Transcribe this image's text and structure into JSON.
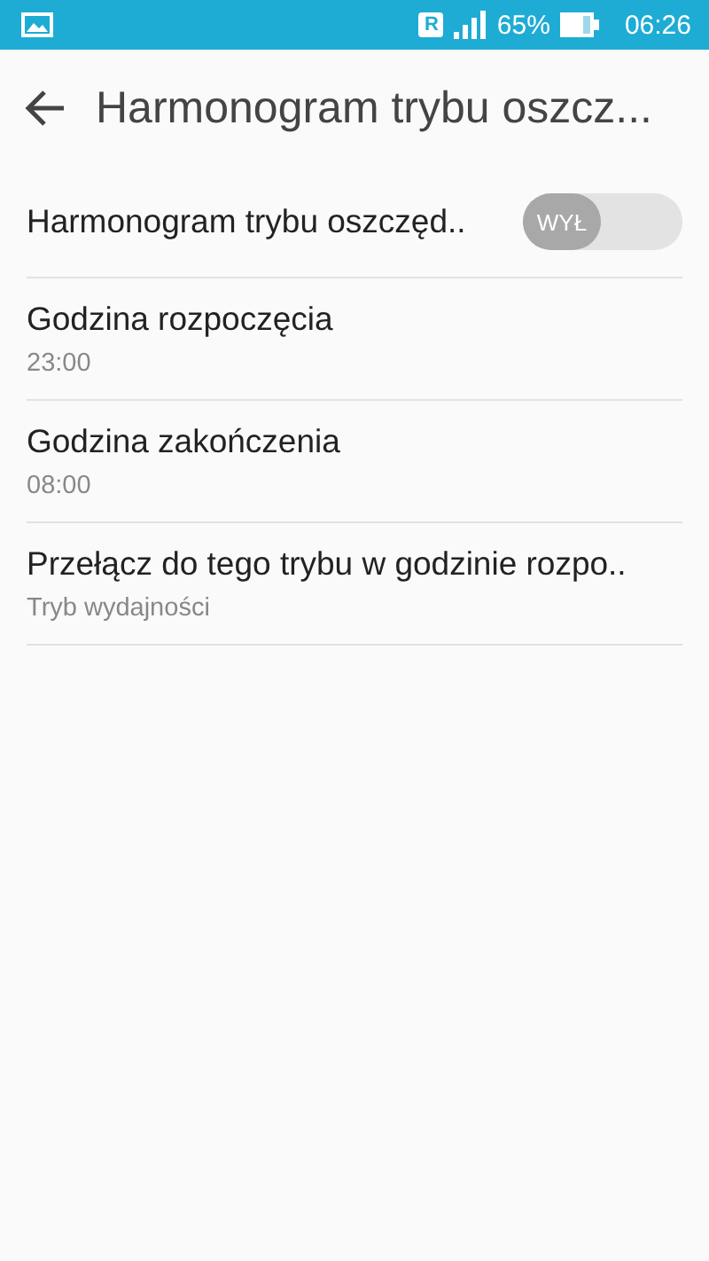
{
  "status_bar": {
    "roaming": "R",
    "battery_text": "65%",
    "time": "06:26"
  },
  "header": {
    "title": "Harmonogram trybu oszcz..."
  },
  "settings": [
    {
      "kind": "toggle",
      "title": "Harmonogram trybu oszczęd..",
      "switch_label": "WYŁ",
      "on": false
    },
    {
      "kind": "value",
      "title": "Godzina rozpoczęcia",
      "value": "23:00"
    },
    {
      "kind": "value",
      "title": "Godzina zakończenia",
      "value": "08:00"
    },
    {
      "kind": "value",
      "title": "Przełącz do tego trybu w godzinie rozpo..",
      "value": "Tryb wydajności"
    }
  ]
}
